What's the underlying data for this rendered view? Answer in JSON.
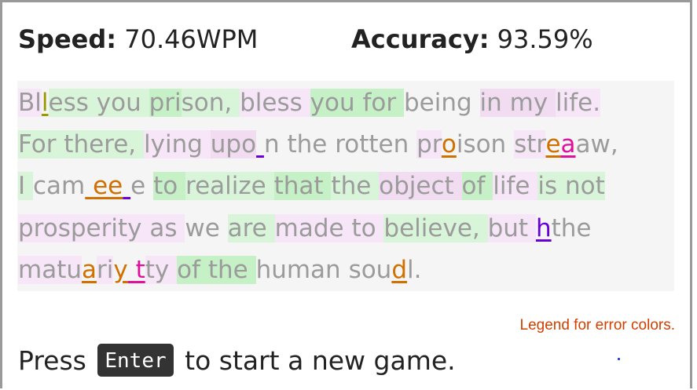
{
  "stats": {
    "speed_label": "Speed:",
    "speed_value": "70.46WPM",
    "accuracy_label": "Accuracy:",
    "accuracy_value": "93.59%"
  },
  "passage": {
    "lines": [
      [
        {
          "t": "B",
          "c": "p1"
        },
        {
          "t": "l",
          "c": "p1"
        },
        {
          "t": "l",
          "e": "olive"
        },
        {
          "t": "ess ",
          "c": "g1"
        },
        {
          "t": "you ",
          "c": "g1"
        },
        {
          "t": "pri",
          "c": "g2"
        },
        {
          "t": "son, ",
          "c": "g1"
        },
        {
          "t": "bless ",
          "c": "p1"
        },
        {
          "t": "you ",
          "c": "g2"
        },
        {
          "t": "for ",
          "c": "g2"
        },
        {
          "t": "being ",
          "c": ""
        },
        {
          "t": "in ",
          "c": "p2"
        },
        {
          "t": "my ",
          "c": "p2"
        },
        {
          "t": "life.",
          "c": "p1"
        }
      ],
      [
        {
          "t": "For ",
          "c": "g1"
        },
        {
          "t": "there, ",
          "c": "g1"
        },
        {
          "t": "lying ",
          "c": "p1"
        },
        {
          "t": "upo",
          "c": "p2"
        },
        {
          "t": " ",
          "e": "purple"
        },
        {
          "t": "n ",
          "c": ""
        },
        {
          "t": "the ",
          "c": ""
        },
        {
          "t": "rotten ",
          "c": ""
        },
        {
          "t": "pr",
          "c": "p1"
        },
        {
          "t": "o",
          "e": "orange"
        },
        {
          "t": "ison ",
          "c": ""
        },
        {
          "t": "str",
          "c": "p1"
        },
        {
          "t": "e",
          "e": "orange"
        },
        {
          "t": "a",
          "e": "magenta"
        },
        {
          "t": "aw,",
          "c": ""
        }
      ],
      [
        {
          "t": "I ",
          "c": "g1"
        },
        {
          "t": "cam",
          "c": ""
        },
        {
          "t": " ",
          "e": "orange"
        },
        {
          "t": "ee",
          "e": "orange"
        },
        {
          "t": " ",
          "e": "purple"
        },
        {
          "t": "e ",
          "c": ""
        },
        {
          "t": "to ",
          "c": "g2"
        },
        {
          "t": "realize ",
          "c": "g1"
        },
        {
          "t": "that ",
          "c": "g2"
        },
        {
          "t": "the ",
          "c": "g1"
        },
        {
          "t": "object ",
          "c": "p2"
        },
        {
          "t": "of ",
          "c": "g2"
        },
        {
          "t": "life ",
          "c": "p1"
        },
        {
          "t": "is ",
          "c": "g1"
        },
        {
          "t": "not",
          "c": "g1"
        }
      ],
      [
        {
          "t": "prosperity ",
          "c": "p1"
        },
        {
          "t": "as ",
          "c": "p1"
        },
        {
          "t": "we ",
          "c": ""
        },
        {
          "t": "are ",
          "c": "g1"
        },
        {
          "t": "made ",
          "c": "p1"
        },
        {
          "t": "to ",
          "c": "p1"
        },
        {
          "t": "believe, ",
          "c": "g1"
        },
        {
          "t": "but ",
          "c": "p1"
        },
        {
          "t": "h",
          "e": "purple"
        },
        {
          "t": "the",
          "c": ""
        }
      ],
      [
        {
          "t": "matu",
          "c": "p1"
        },
        {
          "t": "a",
          "e": "orange"
        },
        {
          "t": "ri",
          "c": "p1"
        },
        {
          "t": "y",
          "e": "orange"
        },
        {
          "t": " ",
          "e": "magenta"
        },
        {
          "t": "t",
          "e": "magenta"
        },
        {
          "t": "ty ",
          "c": "p1"
        },
        {
          "t": "of ",
          "c": "g2"
        },
        {
          "t": "the ",
          "c": "g2"
        },
        {
          "t": "human ",
          "c": ""
        },
        {
          "t": "sou",
          "c": ""
        },
        {
          "t": "d",
          "e": "orange"
        },
        {
          "t": "l.",
          "c": ""
        }
      ]
    ]
  },
  "legend_link": "Legend for error colors.",
  "prompt": {
    "before": "Press",
    "key": "Enter",
    "after": "to start a new game."
  },
  "colors": {
    "text_untyped": "#9b9b9b",
    "error_olive": "#9a9a00",
    "error_orange": "#d07000",
    "error_magenta": "#e0109c",
    "error_purple": "#6a00d8",
    "legend": "#d04000"
  }
}
